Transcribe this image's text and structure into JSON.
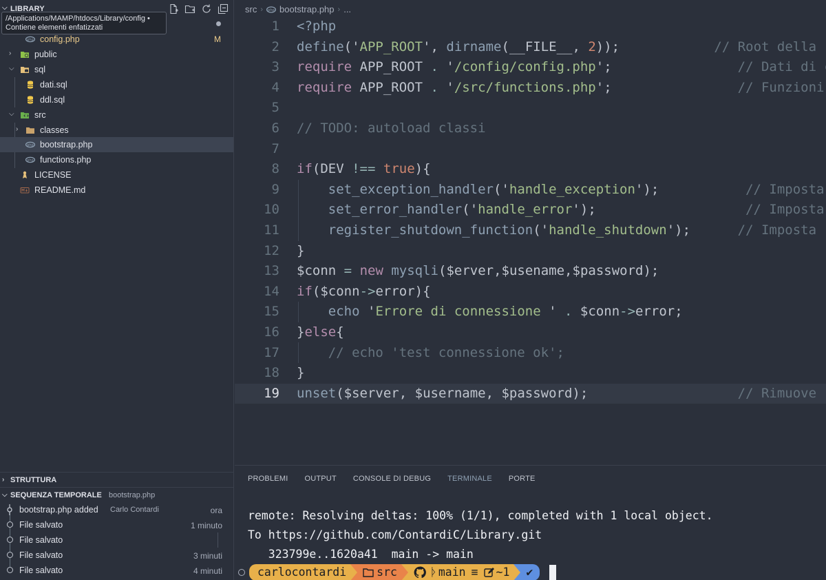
{
  "sidebar": {
    "title": "LIBRARY",
    "tooltip": {
      "line1": "/Applications/MAMP/htdocs/Library/config",
      "line1_suffix": "•",
      "line2": "Contiene elementi enfatizzati"
    },
    "tree": [
      {
        "label": "config.php",
        "badge": "M",
        "icon": "php-file-icon"
      },
      {
        "label": "public",
        "icon": "folder-public-icon"
      },
      {
        "label": "sql",
        "icon": "folder-sql-icon"
      },
      {
        "label": "dati.sql",
        "icon": "database-icon"
      },
      {
        "label": "ddl.sql",
        "icon": "database-icon"
      },
      {
        "label": "src",
        "icon": "folder-src-icon"
      },
      {
        "label": "classes",
        "icon": "folder-icon"
      },
      {
        "label": "bootstrap.php",
        "icon": "php-file-icon"
      },
      {
        "label": "functions.php",
        "icon": "php-file-icon"
      },
      {
        "label": "LICENSE",
        "icon": "license-icon"
      },
      {
        "label": "README.md",
        "icon": "markdown-icon"
      }
    ],
    "outline_title": "STRUTTURA",
    "timeline_title": "SEQUENZA TEMPORALE",
    "timeline_file": "bootstrap.php",
    "timeline": [
      {
        "label": "bootstrap.php added",
        "author": "Carlo Contardi",
        "time": "ora"
      },
      {
        "label": "File salvato",
        "author": "",
        "time": "1 minuto"
      },
      {
        "label": "File salvato",
        "author": "",
        "time": ""
      },
      {
        "label": "File salvato",
        "author": "",
        "time": "3 minuti"
      },
      {
        "label": "File salvato",
        "author": "",
        "time": "4 minuti"
      }
    ]
  },
  "editor": {
    "breadcrumb": {
      "folder": "src",
      "file": "bootstrap.php",
      "more": "..."
    },
    "line_numbers": [
      "1",
      "2",
      "3",
      "4",
      "5",
      "6",
      "7",
      "8",
      "9",
      "10",
      "11",
      "12",
      "13",
      "14",
      "15",
      "16",
      "17",
      "18",
      "19"
    ],
    "current_line": 19
  },
  "panel": {
    "tabs": [
      "PROBLEMI",
      "OUTPUT",
      "CONSOLE DI DEBUG",
      "TERMINALE",
      "PORTE"
    ],
    "active_tab": "TERMINALE",
    "terminal_lines": [
      "remote: Resolving deltas: 100% (1/1), completed with 1 local object.",
      "To https://github.com/ContardiC/Library.git",
      "   323799e..1620a41  main -> main"
    ],
    "prompt": {
      "user": "carlocontardi",
      "dir": "src",
      "branch": "main",
      "branch_status": "≡",
      "changes": "~1",
      "status": "✔"
    }
  },
  "colors": {
    "background": "#2b303b",
    "keyword": "#b48ead",
    "function": "#8fa1b3",
    "string": "#a3be8c",
    "variable": "#bf616a",
    "comment": "#65737e",
    "modified": "#ebcb8b",
    "prompt_user": "#e8b04a",
    "prompt_dir": "#e9834a",
    "prompt_ok": "#5e8fe0"
  }
}
